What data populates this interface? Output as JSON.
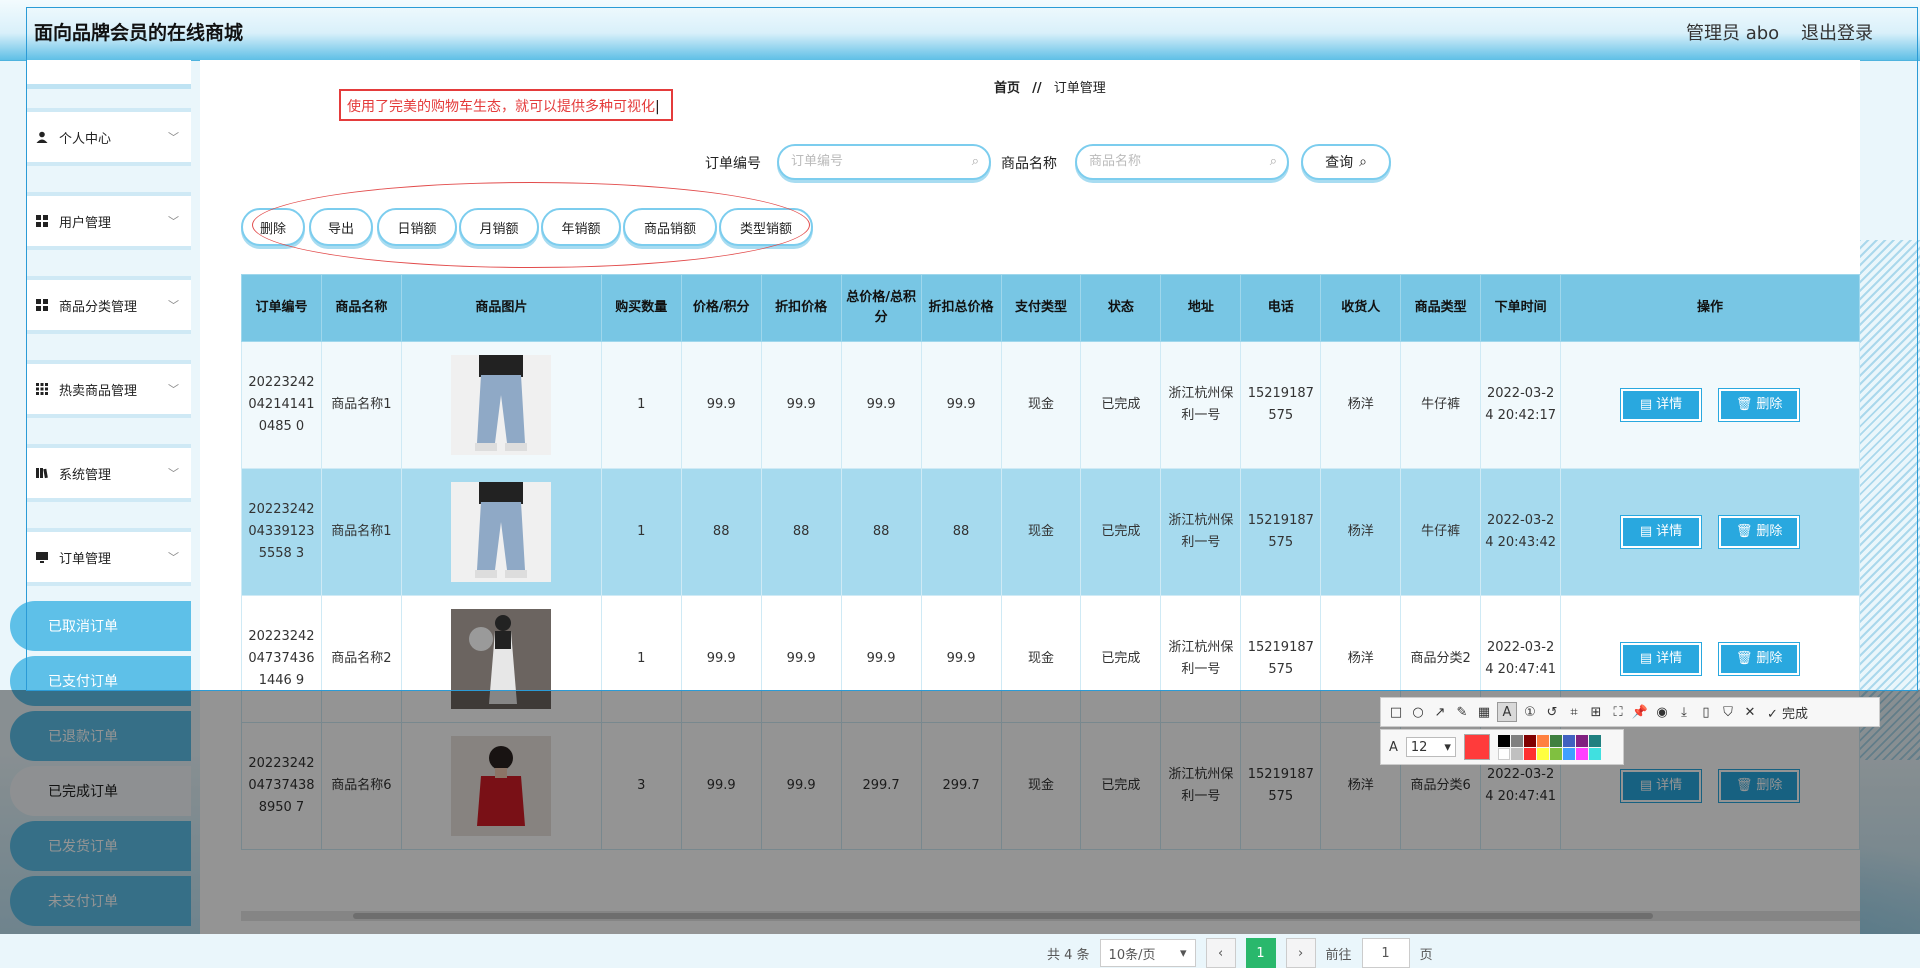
{
  "header": {
    "title": "面向品牌会员的在线商城",
    "admin": "管理员 abo",
    "logout": "退出登录"
  },
  "sidebar": {
    "items": [
      {
        "label": "个人中心",
        "icon": "user-icon"
      },
      {
        "label": "用户管理",
        "icon": "grid-icon"
      },
      {
        "label": "商品分类管理",
        "icon": "grid-icon"
      },
      {
        "label": "热卖商品管理",
        "icon": "grid-dots-icon"
      },
      {
        "label": "系统管理",
        "icon": "book-icon"
      },
      {
        "label": "订单管理",
        "icon": "monitor-icon"
      }
    ],
    "subitems": [
      "已取消订单",
      "已支付订单",
      "已退款订单",
      "已完成订单",
      "已发货订单",
      "未支付订单"
    ]
  },
  "breadcrumb": {
    "home": "首页",
    "sep": "//",
    "current": "订单管理"
  },
  "annotation": {
    "text": "使用了完美的购物车生态，就可以提供多种可视化"
  },
  "search": {
    "order_label": "订单编号",
    "order_placeholder": "订单编号",
    "product_label": "商品名称",
    "product_placeholder": "商品名称",
    "query": "查询"
  },
  "actions": [
    "删除",
    "导出",
    "日销额",
    "月销额",
    "年销额",
    "商品销额",
    "类型销额"
  ],
  "table": {
    "columns": [
      "订单编号",
      "商品名称",
      "商品图片",
      "购买数量",
      "价格/积分",
      "折扣价格",
      "总价格/总积分",
      "折扣总价格",
      "支付类型",
      "状态",
      "地址",
      "电话",
      "收货人",
      "商品类型",
      "下单时间",
      "操作"
    ],
    "rows": [
      {
        "order": "20223242042141410485 0",
        "name": "商品名称1",
        "qty": "1",
        "price": "99.9",
        "discount": "99.9",
        "total": "99.9",
        "dtotal": "99.9",
        "pay": "现金",
        "status": "已完成",
        "addr": "浙江杭州保利一号",
        "phone": "15219187575",
        "receiver": "杨洋",
        "type": "牛仔裤",
        "time": "2022-03-24 20:42:17"
      },
      {
        "order": "20223242043391235558 3",
        "name": "商品名称1",
        "qty": "1",
        "price": "88",
        "discount": "88",
        "total": "88",
        "dtotal": "88",
        "pay": "现金",
        "status": "已完成",
        "addr": "浙江杭州保利一号",
        "phone": "15219187575",
        "receiver": "杨洋",
        "type": "牛仔裤",
        "time": "2022-03-24 20:43:42"
      },
      {
        "order": "20223242047374361446 9",
        "name": "商品名称2",
        "qty": "1",
        "price": "99.9",
        "discount": "99.9",
        "total": "99.9",
        "dtotal": "99.9",
        "pay": "现金",
        "status": "已完成",
        "addr": "浙江杭州保利一号",
        "phone": "15219187575",
        "receiver": "杨洋",
        "type": "商品分类2",
        "time": "2022-03-24 20:47:41"
      },
      {
        "order": "20223242047374388950 7",
        "name": "商品名称6",
        "qty": "3",
        "price": "99.9",
        "discount": "99.9",
        "total": "299.7",
        "dtotal": "299.7",
        "pay": "现金",
        "status": "已完成",
        "addr": "浙江杭州保利一号",
        "phone": "15219187575",
        "receiver": "杨洋",
        "type": "商品分类6",
        "time": "2022-03-24 20:47:41"
      }
    ],
    "detail": "详情",
    "delete": "删除"
  },
  "pager": {
    "total": "共 4 条",
    "size": "10条/页",
    "prev": "‹",
    "current": "1",
    "next": "›",
    "goto": "前往",
    "goto_value": "1",
    "page": "页"
  },
  "capture_toolbar": {
    "finish": "完成",
    "font_size": "12"
  }
}
